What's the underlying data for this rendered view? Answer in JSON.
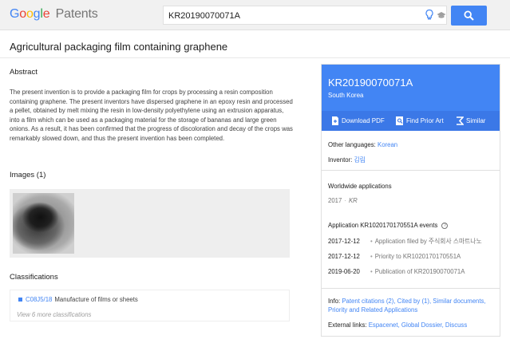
{
  "header": {
    "logo": {
      "letters": [
        "G",
        "o",
        "o",
        "g",
        "l",
        "e"
      ],
      "product": "Patents"
    },
    "search": {
      "value": "KR20190070071A"
    },
    "icons": [
      "lightbulb-icon",
      "graduation-cap-icon",
      "search-icon"
    ]
  },
  "document": {
    "title": "Agricultural packaging film containing graphene",
    "abstract_heading": "Abstract",
    "abstract": "The present invention is to provide a packaging film for crops by processing a resin composition containing graphene. The present inventors have dispersed graphene in an epoxy resin and processed a pellet, obtained by melt mixing the resin in low-density polyethylene using an extrusion apparatus, into a film which can be used as a packaging material for the storage of bananas and large green onions. As a result, it has been confirmed that the progress of discoloration and decay of the crops was remarkably slowed down, and thus the present invention has been completed.",
    "images_heading": "Images (1)",
    "classifications_heading": "Classifications",
    "classification": {
      "code": "C08J5/18",
      "description": "Manufacture of films or sheets"
    },
    "view_more": "View 6 more classifications"
  },
  "panel": {
    "pub_number": "KR20190070071A",
    "country": "South Korea",
    "actions": [
      {
        "label": "Download PDF",
        "icon": "pdf-icon"
      },
      {
        "label": "Find Prior Art",
        "icon": "prior-art-icon"
      },
      {
        "label": "Similar",
        "icon": "similar-icon"
      }
    ],
    "other_languages_label": "Other languages:",
    "other_languages_value": "Korean",
    "inventor_label": "Inventor:",
    "inventor_value": "김림",
    "worldwide_heading": "Worldwide applications",
    "worldwide_year": "2017",
    "worldwide_country": "KR",
    "events_heading": "Application KR1020170170551A events",
    "events": [
      {
        "date": "2017-12-12",
        "text": "Application filed by ",
        "link": "주식회사 스마트나노"
      },
      {
        "date": "2017-12-12",
        "text": "Priority to KR1020170170551A",
        "link": ""
      },
      {
        "date": "2019-06-20",
        "text": "Publication of KR20190070071A",
        "link": ""
      }
    ],
    "info_label": "Info:",
    "info_links": "Patent citations (2), Cited by (1), Similar documents, Priority and Related Applications",
    "external_label": "External links:",
    "external_links": "Espacenet, Global Dossier, Discuss"
  },
  "colors": {
    "accent": "#4285f4",
    "accent_dark": "#3b78e7"
  }
}
